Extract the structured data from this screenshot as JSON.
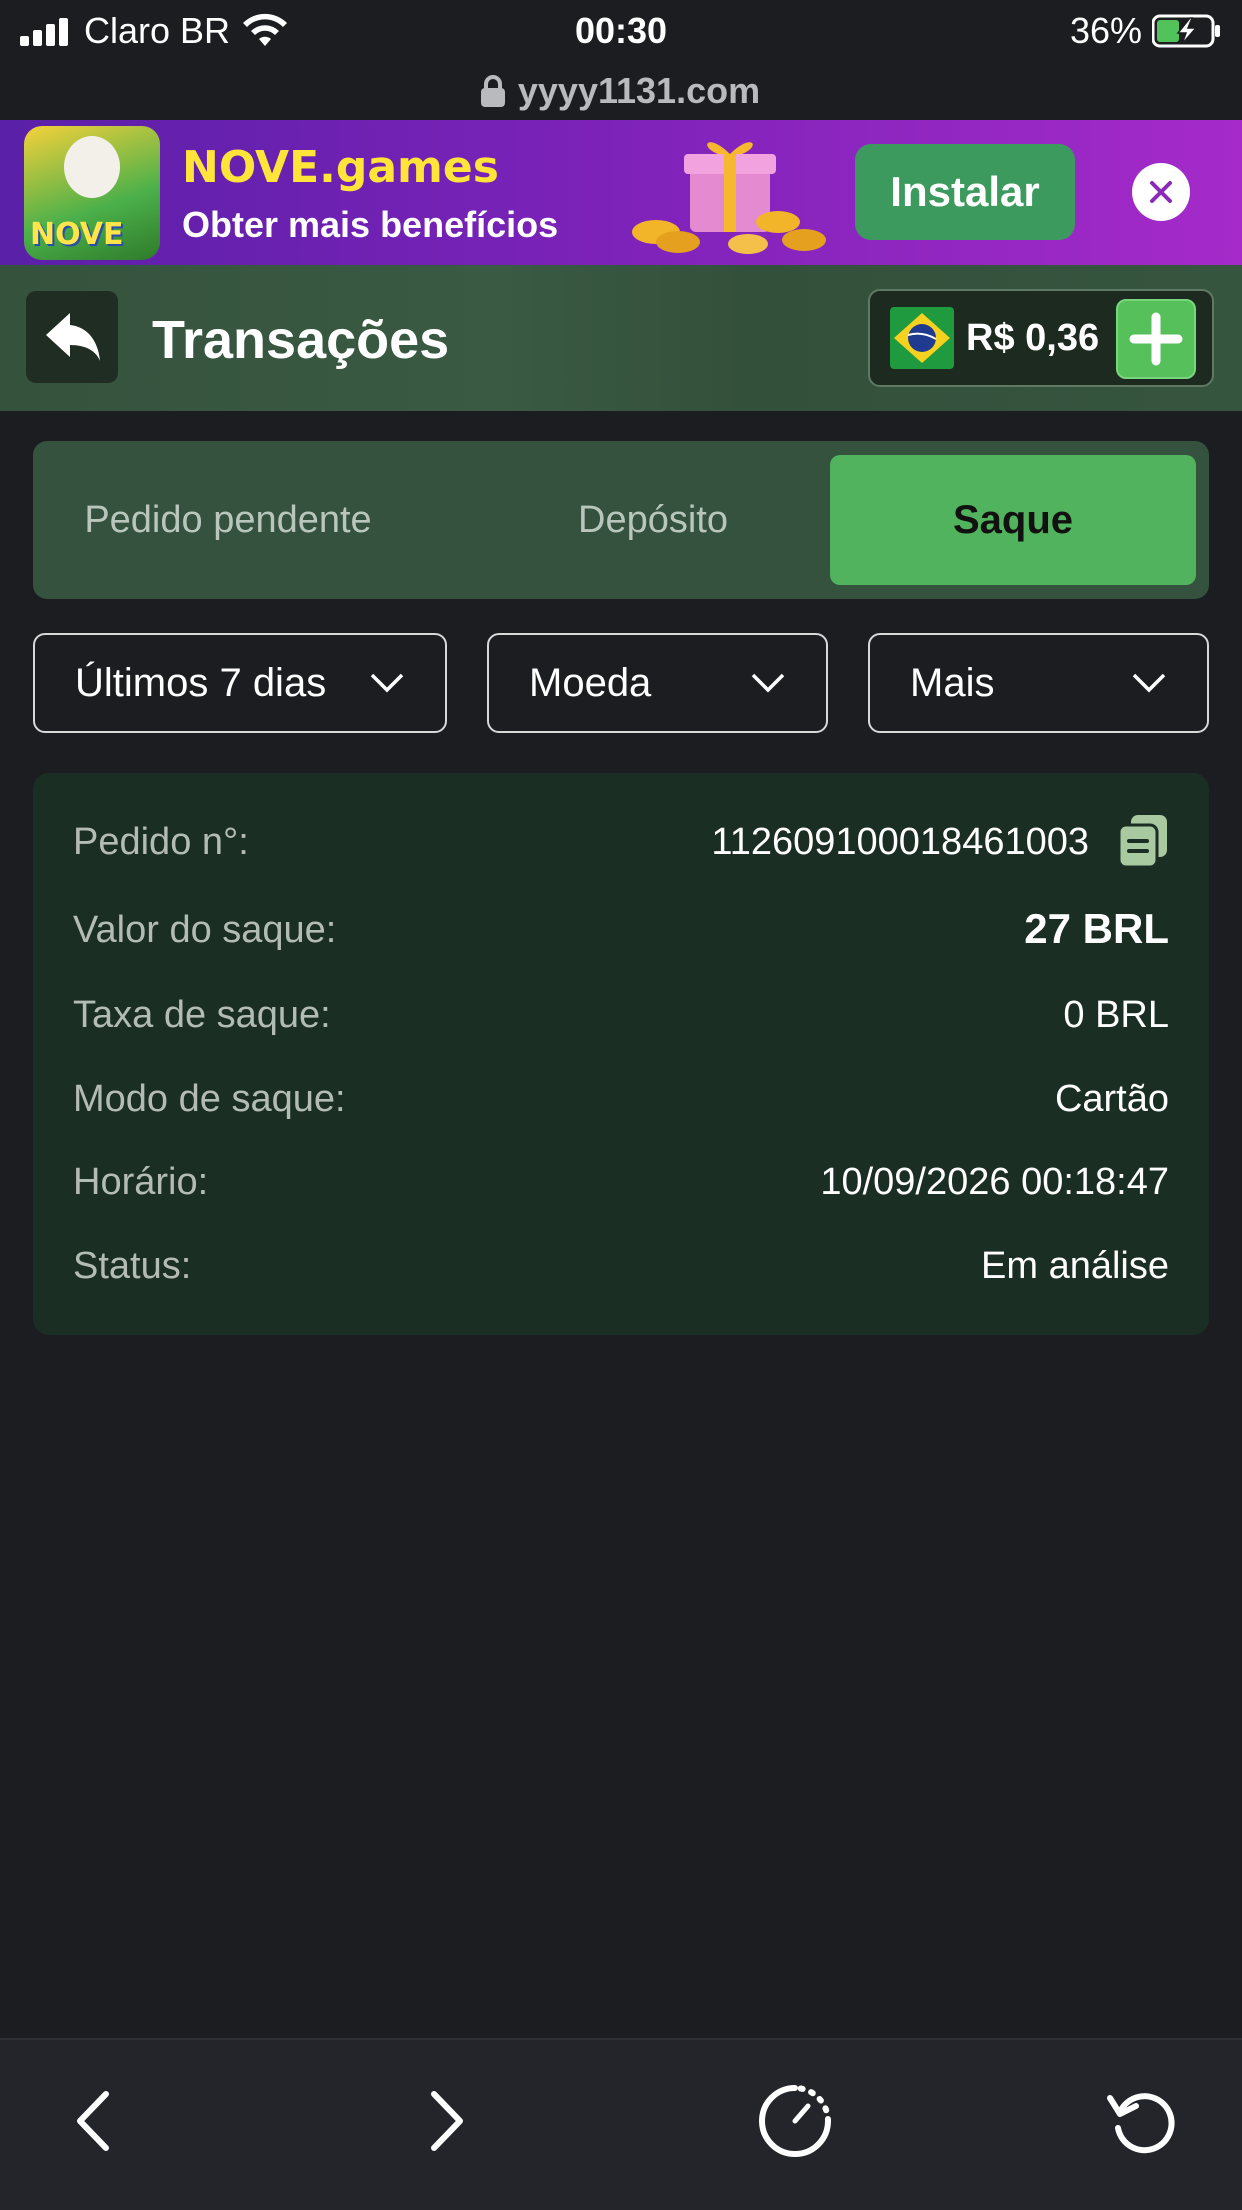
{
  "status_bar": {
    "carrier": "Claro BR",
    "time": "00:30",
    "battery": "36%",
    "url": "yyyy1131.com"
  },
  "banner": {
    "app_name": "NOVE.games",
    "subtitle": "Obter mais benefícios",
    "install_label": "Instalar",
    "icon_text": "NOVE"
  },
  "header": {
    "title": "Transações",
    "balance": "R$ 0,36"
  },
  "tabs": [
    {
      "label": "Pedido pendente",
      "active": false
    },
    {
      "label": "Depósito",
      "active": false
    },
    {
      "label": "Saque",
      "active": true
    }
  ],
  "filters": {
    "period": "Últimos 7 dias",
    "currency": "Moeda",
    "more": "Mais"
  },
  "transaction": {
    "order_label": "Pedido n°:",
    "order_value": "112609100018461003",
    "amount_label": "Valor do saque:",
    "amount_value": "27 BRL",
    "fee_label": "Taxa de saque:",
    "fee_value": "0 BRL",
    "mode_label": "Modo de saque:",
    "mode_value": "Cartão",
    "time_label": "Horário:",
    "time_value": "10/09/2026 00:18:47",
    "status_label": "Status:",
    "status_value": "Em análise"
  },
  "colors": {
    "accent_green": "#52b35e",
    "banner_purple": "#7a22b8",
    "card_bg": "#1b2e23",
    "page_bg": "#1c1d21"
  }
}
